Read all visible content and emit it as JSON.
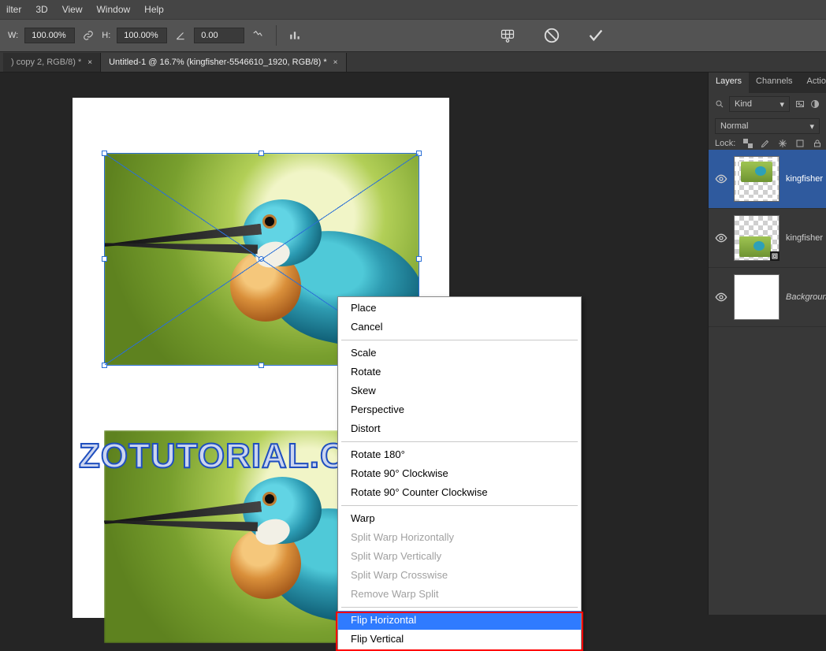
{
  "menu": {
    "items": [
      "ilter",
      "3D",
      "View",
      "Window",
      "Help"
    ]
  },
  "options": {
    "w_label": "W:",
    "w_value": "100.00%",
    "link": "⛓",
    "h_label": "H:",
    "h_value": "100.00%",
    "angle_value": "0.00"
  },
  "tabs": [
    {
      "label": ") copy 2, RGB/8) *",
      "active": false,
      "close": "×"
    },
    {
      "label": "Untitled-1 @ 16.7% (kingfisher-5546610_1920, RGB/8) *",
      "active": true,
      "close": "×"
    }
  ],
  "contextMenu": {
    "groups": [
      {
        "items": [
          {
            "t": "Place"
          },
          {
            "t": "Cancel"
          }
        ]
      },
      {
        "items": [
          {
            "t": "Scale"
          },
          {
            "t": "Rotate"
          },
          {
            "t": "Skew"
          },
          {
            "t": "Perspective"
          },
          {
            "t": "Distort"
          }
        ]
      },
      {
        "items": [
          {
            "t": "Rotate 180°"
          },
          {
            "t": "Rotate 90° Clockwise"
          },
          {
            "t": "Rotate 90° Counter Clockwise"
          }
        ]
      },
      {
        "items": [
          {
            "t": "Warp"
          },
          {
            "t": "Split Warp Horizontally",
            "d": true
          },
          {
            "t": "Split Warp Vertically",
            "d": true
          },
          {
            "t": "Split Warp Crosswise",
            "d": true
          },
          {
            "t": "Remove Warp Split",
            "d": true
          }
        ]
      },
      {
        "items": [
          {
            "t": "Flip Horizontal",
            "sel": true
          },
          {
            "t": "Flip Vertical"
          }
        ]
      }
    ]
  },
  "watermark": "ZOTUTORIAL.COM",
  "layersPanel": {
    "tabs": [
      "Layers",
      "Channels",
      "Actions"
    ],
    "filter": "Kind",
    "blend": "Normal",
    "lockLabel": "Lock:",
    "layers": [
      {
        "name": "kingfisher",
        "selected": true,
        "smart": true,
        "thumb": "trans-top"
      },
      {
        "name": "kingfisher",
        "selected": false,
        "smart": true,
        "thumb": "trans-bot"
      },
      {
        "name": "Background",
        "selected": false,
        "smart": false,
        "thumb": "white",
        "italic": true
      }
    ]
  }
}
